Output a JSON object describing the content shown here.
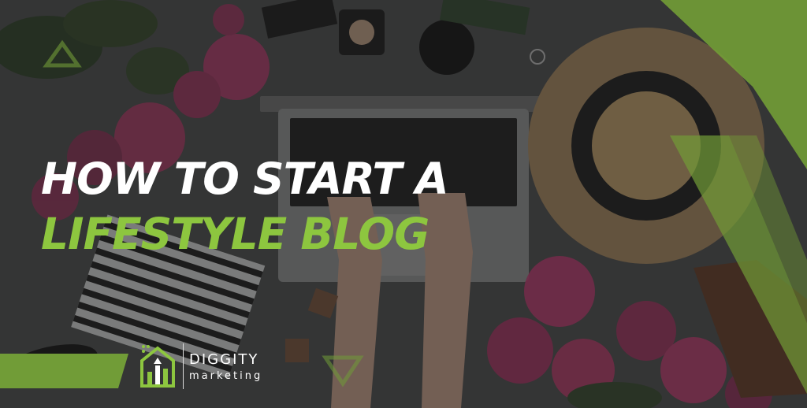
{
  "headline": {
    "line1": "HOW TO START A",
    "line2": "LIFESTYLE BLOG"
  },
  "brand": {
    "name": "DIGGITY",
    "sub": "marketing",
    "icon": "house-arrow-logo-icon"
  },
  "colors": {
    "accent": "#8dc63f",
    "headline": "#ffffff",
    "overlay": "#1e1f1f"
  }
}
